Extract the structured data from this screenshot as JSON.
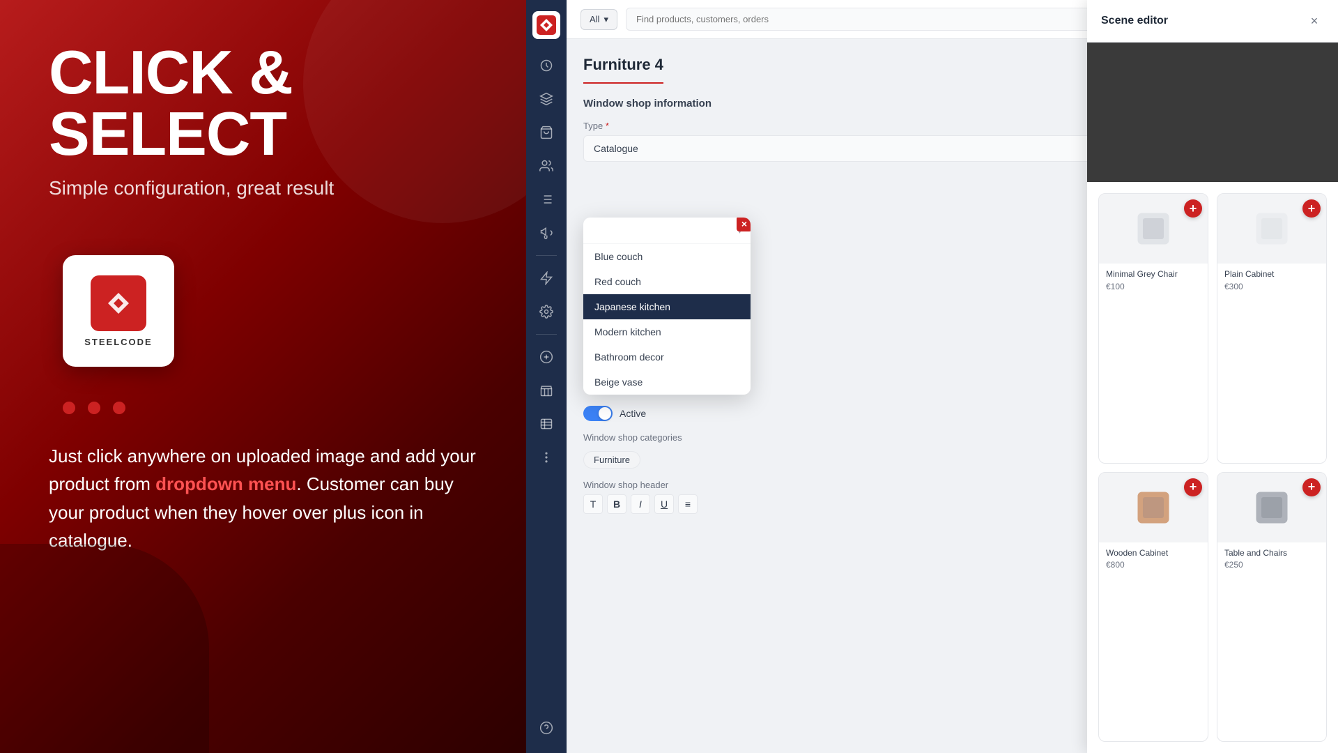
{
  "left": {
    "headline": "CLICK & SELECT",
    "subheadline": "Simple configuration, great result",
    "logo_text": "STEELCODE",
    "dots": [
      1,
      2,
      3
    ],
    "description_part1": "Just click anywhere on uploaded image and add your product from ",
    "description_highlight": "dropdown menu",
    "description_part2": ". Customer can buy your product when they hover over plus icon in catalogue."
  },
  "topbar": {
    "filter_label": "All",
    "search_placeholder": "Find products, customers, orders"
  },
  "page": {
    "title": "Furniture 4",
    "section_title": "Window shop information",
    "type_label": "Type",
    "type_value": "Catalogue",
    "active_label": "Active",
    "categories_label": "Window shop categories",
    "category_tag": "Furniture",
    "header_label": "Window shop header"
  },
  "dropdown": {
    "close_icon": "×",
    "items": [
      {
        "label": "Blue couch",
        "selected": false
      },
      {
        "label": "Red couch",
        "selected": false
      },
      {
        "label": "Japanese kitchen",
        "selected": true
      },
      {
        "label": "Modern kitchen",
        "selected": false
      },
      {
        "label": "Bathroom decor",
        "selected": false
      },
      {
        "label": "Beige vase",
        "selected": false
      }
    ]
  },
  "scene_editor": {
    "title": "Scene editor",
    "close_icon": "×",
    "products": [
      {
        "name": "Minimal Grey Chair",
        "price": "€100",
        "type": "chair"
      },
      {
        "name": "Plain Cabinet",
        "price": "€300",
        "type": "plain-cabinet"
      },
      {
        "name": "Wooden Cabinet",
        "price": "€800",
        "type": "cabinet"
      },
      {
        "name": "Table and Chairs",
        "price": "€250",
        "type": "table"
      }
    ]
  },
  "sidebar": {
    "items": [
      {
        "icon": "dashboard",
        "label": "Dashboard"
      },
      {
        "icon": "layers",
        "label": "Layers"
      },
      {
        "icon": "bag",
        "label": "Bag"
      },
      {
        "icon": "users",
        "label": "Users"
      },
      {
        "icon": "list",
        "label": "List"
      },
      {
        "icon": "megaphone",
        "label": "Megaphone"
      },
      {
        "icon": "lightning",
        "label": "Lightning"
      },
      {
        "icon": "settings",
        "label": "Settings"
      },
      {
        "icon": "plus-circle",
        "label": "Add"
      },
      {
        "icon": "store",
        "label": "Store"
      },
      {
        "icon": "table",
        "label": "Table"
      },
      {
        "icon": "more",
        "label": "More"
      },
      {
        "icon": "help",
        "label": "Help"
      }
    ]
  }
}
